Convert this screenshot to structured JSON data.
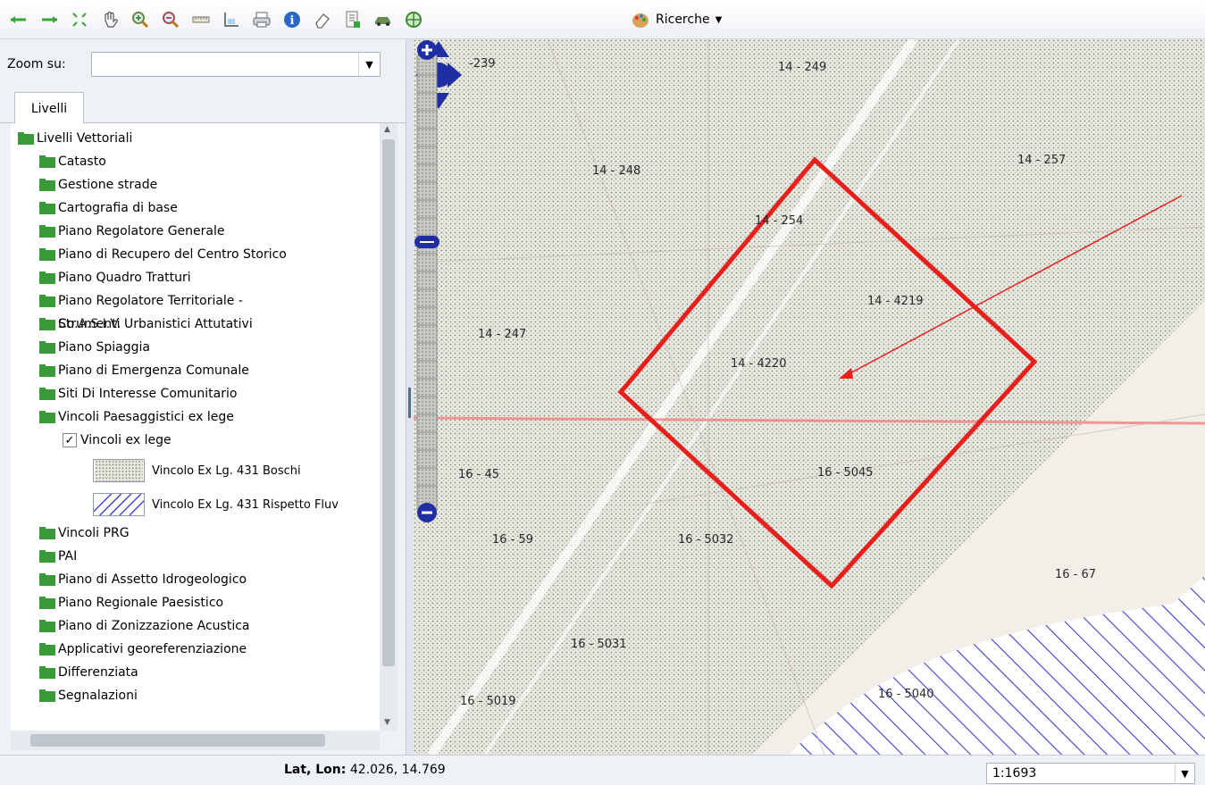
{
  "toolbar": {
    "search_label": "Ricerche",
    "icons": [
      "arrow-left-icon",
      "arrow-right-icon",
      "full-extent-icon",
      "pan-hand-icon",
      "zoom-in-icon",
      "zoom-out-icon",
      "ruler-icon",
      "area-measure-icon",
      "print-icon",
      "info-icon",
      "eraser-icon",
      "document-list-icon",
      "car-icon",
      "target-icon",
      "palette-icon"
    ]
  },
  "left_panel": {
    "zoom_label": "Zoom su:",
    "zoom_value": "",
    "tab_label": "Livelli",
    "tree": {
      "root": "Livelli Vettoriali",
      "items": [
        "Catasto",
        "Gestione strade",
        "Cartografia di base",
        "Piano Regolatore Generale",
        "Piano di Recupero del Centro Storico",
        "Piano Quadro Tratturi",
        "Piano Regolatore Territoriale -",
        "Strumenti Urbanistici Attutativi",
        "Piano Spiaggia",
        "Piano di Emergenza Comunale",
        "Siti Di Interesse Comunitario",
        "Vincoli Paesaggistici ex lege"
      ],
      "overlap_text": "Co.A.S.I.V.",
      "checked_layer": "Vincoli ex lege",
      "legend": [
        {
          "label": "Vincolo Ex Lg. 431 Boschi"
        },
        {
          "label": "Vincolo Ex Lg. 431 Rispetto Fluv"
        }
      ],
      "items_after": [
        "Vincoli PRG",
        "PAI",
        "Piano di Assetto Idrogeologico",
        "Piano Regionale Paesistico",
        "Piano di Zonizzazione Acustica",
        "Applicativi georeferenziazione",
        "Differenziata",
        "Segnalazioni"
      ]
    }
  },
  "map": {
    "parcels": [
      "-239",
      "14 - 249",
      "14 - 248",
      "14 - 257",
      "14 - 254",
      "14 - 4219",
      "14 - 247",
      "14 - 4220",
      "16 - 45",
      "16 - 5045",
      "16 - 59",
      "16 - 5032",
      "16 - 67",
      "16 - 5031",
      "16 - 5040",
      "16 - 5019"
    ],
    "highlight_color": "#e8201c"
  },
  "status": {
    "coord_label": "Lat, Lon:",
    "coord_value": "42.026, 14.769",
    "scale": "1:1693"
  }
}
